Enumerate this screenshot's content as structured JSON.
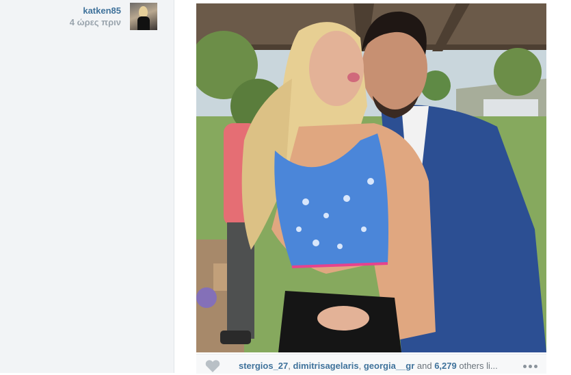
{
  "post": {
    "author": "katken85",
    "time_ago": "4 ώρες πριν",
    "avatar_icon": "user-avatar",
    "photo_icon": "post-photo"
  },
  "likes": {
    "liker_1": "stergios_27",
    "sep_1": ", ",
    "liker_2": "dimitrisagelaris",
    "sep_2": ", ",
    "liker_3": "georgia__gr",
    "and_word": " and ",
    "count": "6,279",
    "others_text": " others li..."
  },
  "icons": {
    "like": "heart-icon",
    "more": "more-options-icon"
  },
  "colors": {
    "link": "#3f729b",
    "muted": "#9aa4ad",
    "sidebar_bg": "#f2f4f6"
  }
}
